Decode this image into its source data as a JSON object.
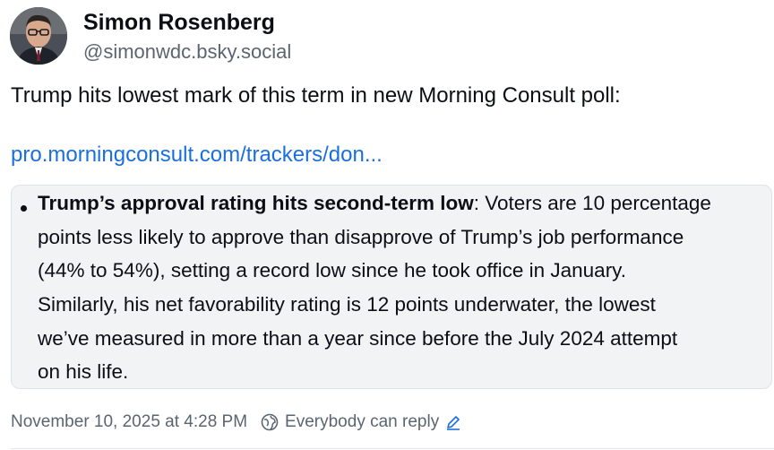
{
  "author": {
    "display_name": "Simon Rosenberg",
    "handle": "@simonwdc.bsky.social",
    "avatar_icon": "profile-photo"
  },
  "post": {
    "text": "Trump hits lowest mark of this term in new Morning Consult poll:",
    "link_text": "pro.morningconsult.com/trackers/don..."
  },
  "quote": {
    "bold_lead": "Trump’s approval rating hits second-term low",
    "lines": [
      ": Voters are 10 percentage",
      "points less likely to approve than disapprove of Trump’s job performance",
      "(44% to 54%), setting a record low since he took office in January.",
      "Similarly, his net favorability rating is 12 points underwater, the lowest",
      "we’ve measured in more than a year since before the July 2024 attempt",
      "on his life."
    ]
  },
  "meta": {
    "timestamp": "November 10, 2025 at 4:28 PM",
    "reply_setting": "Everybody can reply",
    "reply_icon": "globe-icon",
    "edit_icon": "pencil-icon"
  },
  "colors": {
    "link": "#1a6fe0",
    "muted": "#5b6570",
    "quote_bg": "#f1f3f5"
  }
}
